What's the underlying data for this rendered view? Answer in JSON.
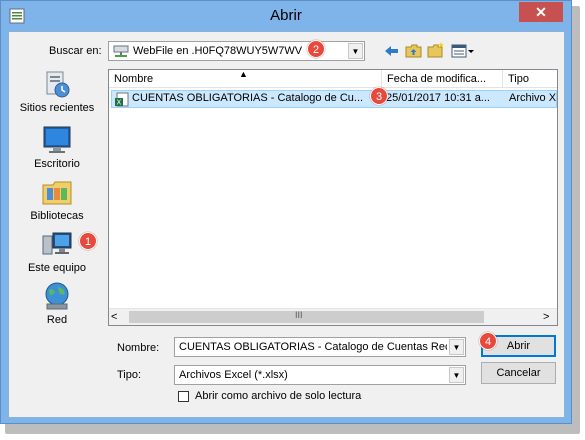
{
  "window": {
    "title": "Abrir",
    "close_glyph": "✕"
  },
  "lookin": {
    "label": "Buscar en:",
    "value": "WebFile en .H0FQ78WUY5W7WV",
    "icon": "network-drive-icon"
  },
  "places": [
    {
      "label": "Sitios recientes",
      "icon": "recent-places-icon"
    },
    {
      "label": "Escritorio",
      "icon": "desktop-icon"
    },
    {
      "label": "Bibliotecas",
      "icon": "libraries-icon"
    },
    {
      "label": "Este equipo",
      "icon": "computer-icon"
    },
    {
      "label": "Red",
      "icon": "network-icon"
    }
  ],
  "columns": {
    "name": "Nombre",
    "date": "Fecha de modifica...",
    "type": "Tipo"
  },
  "files": [
    {
      "name": "CUENTAS OBLIGATORIAS - Catalogo de Cu...",
      "date": "25/01/2017 10:31 a...",
      "type": "Archivo X",
      "icon": "excel-file-icon"
    }
  ],
  "scroll": {
    "left": "<",
    "grip": "III",
    "right": ">"
  },
  "filename": {
    "label": "Nombre:",
    "value": "CUENTAS OBLIGATORIAS - Catalogo de Cuentas Reco"
  },
  "filetype": {
    "label": "Tipo:",
    "value": "Archivos Excel (*.xlsx)"
  },
  "readonly": {
    "label": "Abrir como archivo de solo lectura",
    "checked": false
  },
  "buttons": {
    "open": "Abrir",
    "cancel": "Cancelar"
  },
  "badges": [
    "1",
    "2",
    "3",
    "4"
  ],
  "colors": {
    "title_bar": "#7eb4ea",
    "badge": "#e74a3c",
    "selection": "#cce8ff",
    "close": "#c75050"
  }
}
